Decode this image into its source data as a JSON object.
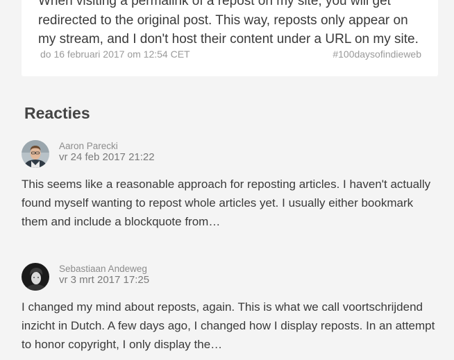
{
  "post": {
    "text": "When visiting a permalink of a repost on my site, you will get redirected to the original post. This way, reposts only appear on my stream, and I don't host their content under a URL on my site.",
    "date": "do 16 februari 2017 om 12:54 CET",
    "tag": "#100daysofindieweb"
  },
  "reactions": {
    "heading": "Reacties",
    "items": [
      {
        "author": "Aaron Parecki",
        "date": "vr 24 feb 2017 21:22",
        "body": "This seems like a reasonable approach for reposting articles. I haven't actually found myself wanting to repost whole articles yet. I usually either bookmark them and include a blockquote from…"
      },
      {
        "author": "Sebastiaan Andeweg",
        "date": "vr 3 mrt 2017 17:25",
        "body": "I changed my mind about reposts, again. This is what we call voortschrijdend inzicht in Dutch. A few days ago, I changed how I display reposts. In an attempt to honor copyright, I only display the…"
      }
    ]
  }
}
